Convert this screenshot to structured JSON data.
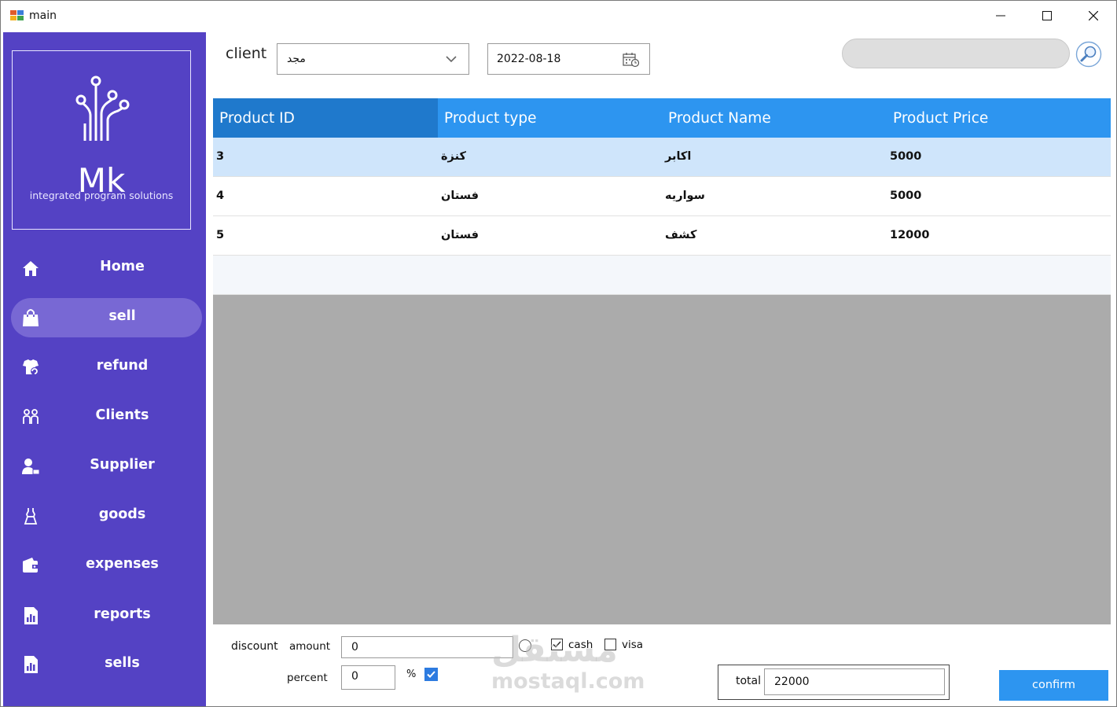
{
  "window": {
    "title": "main"
  },
  "sidebar": {
    "logo": {
      "mark": "Mk",
      "tagline": "integrated program solutions"
    },
    "items": [
      {
        "label": "Home",
        "icon": "home-icon",
        "active": false
      },
      {
        "label": "sell",
        "icon": "shopping-bag-icon",
        "active": true
      },
      {
        "label": "refund",
        "icon": "refund-shirt-icon",
        "active": false
      },
      {
        "label": "Clients",
        "icon": "clients-icon",
        "active": false
      },
      {
        "label": "Supplier",
        "icon": "supplier-icon",
        "active": false
      },
      {
        "label": "goods",
        "icon": "dress-icon",
        "active": false
      },
      {
        "label": "expenses",
        "icon": "wallet-icon",
        "active": false
      },
      {
        "label": "reports",
        "icon": "report-icon",
        "active": false
      },
      {
        "label": "sells",
        "icon": "report-icon",
        "active": false
      }
    ],
    "colors": {
      "background": "#5442c4",
      "active": "#7868d4"
    }
  },
  "filters": {
    "client_label": "client",
    "client_value": "مجد",
    "date_value": "2022-08-18",
    "search_placeholder": ""
  },
  "grid": {
    "columns": [
      "Product ID",
      "Product type",
      "Product Name",
      "Product Price"
    ],
    "rows": [
      [
        "3",
        "كنزة",
        "اكابر",
        "5000"
      ],
      [
        "4",
        "فستان",
        "سواريه",
        "5000"
      ],
      [
        "5",
        "فستان",
        "كشف",
        "12000"
      ]
    ],
    "colors": {
      "header": "#2d95f0",
      "selected_row": "#cfe5fb"
    }
  },
  "payment": {
    "discount_label": "discount",
    "amount_label": "amount",
    "amount_value": "0",
    "percent_label": "percent",
    "percent_value": "0",
    "percent_sign": "%",
    "percent_checked": true,
    "cash_label": "cash",
    "cash_checked": true,
    "visa_label": "visa",
    "visa_checked": false,
    "total_label": "total",
    "total_value": "22000",
    "confirm_label": "confirm"
  },
  "watermark": {
    "arabic": "مستقل",
    "latin": "mostaql.com"
  }
}
